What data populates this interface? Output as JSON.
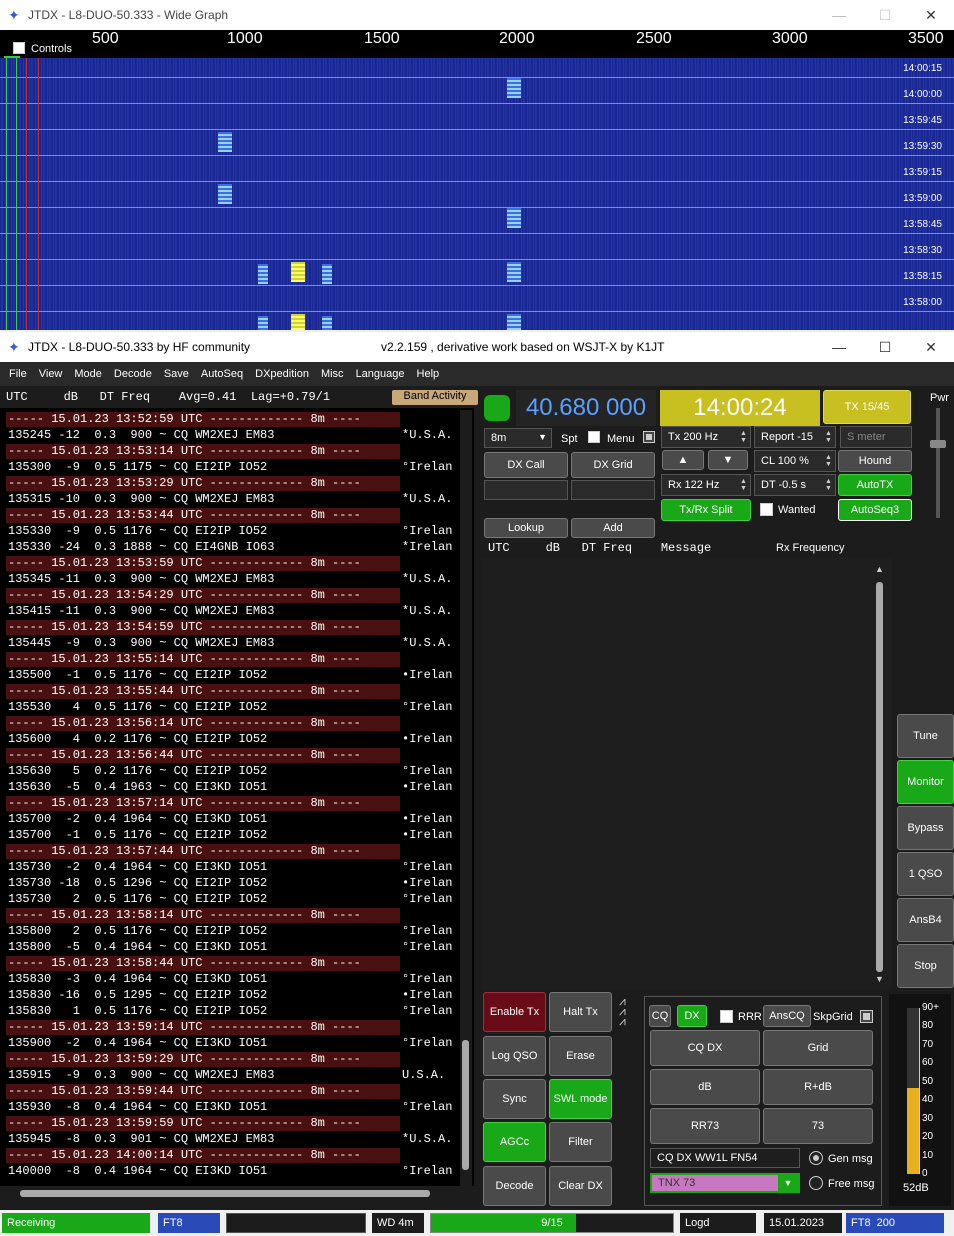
{
  "wide_graph": {
    "title": "JTDX - L8-DUO-50.333 - Wide Graph",
    "controls_label": "Controls",
    "scale_ticks": [
      "500",
      "1000",
      "1500",
      "2000",
      "2500",
      "3000",
      "3500"
    ],
    "times": [
      "14:00:15",
      "14:00:00",
      "13:59:45",
      "13:59:30",
      "13:59:15",
      "13:59:00",
      "13:58:45",
      "13:58:30",
      "13:58:15",
      "13:58:00"
    ]
  },
  "main": {
    "title_left": "JTDX - L8-DUO-50.333  by HF community",
    "title_right": "v2.2.159 , derivative work based on WSJT-X by K1JT",
    "menu": [
      "File",
      "View",
      "Mode",
      "Decode",
      "Save",
      "AutoSeq",
      "DXpedition",
      "Misc",
      "Language",
      "Help"
    ],
    "left_header": "UTC     dB   DT Freq    Avg=0.41  Lag=+0.79/1",
    "band_activity": "Band Activity",
    "lines": [
      {
        "t": "sep",
        "text": "----- 15.01.23 13:52:59 UTC ------------- 8m ----"
      },
      {
        "t": "msg",
        "text": "135245 -12  0.3  900 ~ CQ WM2XEJ EM83",
        "cty": "*U.S.A."
      },
      {
        "t": "sep",
        "text": "----- 15.01.23 13:53:14 UTC ------------- 8m ----"
      },
      {
        "t": "msg",
        "text": "135300  -9  0.5 1175 ~ CQ EI2IP IO52",
        "cty": "°Irelan"
      },
      {
        "t": "sep",
        "text": "----- 15.01.23 13:53:29 UTC ------------- 8m ----"
      },
      {
        "t": "msg",
        "text": "135315 -10  0.3  900 ~ CQ WM2XEJ EM83",
        "cty": "*U.S.A."
      },
      {
        "t": "sep",
        "text": "----- 15.01.23 13:53:44 UTC ------------- 8m ----"
      },
      {
        "t": "msg",
        "text": "135330  -9  0.5 1176 ~ CQ EI2IP IO52",
        "cty": "°Irelan"
      },
      {
        "t": "msg",
        "text": "135330 -24  0.3 1888 ~ CQ EI4GNB IO63",
        "cty": "*Irelan"
      },
      {
        "t": "sep",
        "text": "----- 15.01.23 13:53:59 UTC ------------- 8m ----"
      },
      {
        "t": "msg",
        "text": "135345 -11  0.3  900 ~ CQ WM2XEJ EM83",
        "cty": "*U.S.A."
      },
      {
        "t": "sep",
        "text": "----- 15.01.23 13:54:29 UTC ------------- 8m ----"
      },
      {
        "t": "msg",
        "text": "135415 -11  0.3  900 ~ CQ WM2XEJ EM83",
        "cty": "*U.S.A."
      },
      {
        "t": "sep",
        "text": "----- 15.01.23 13:54:59 UTC ------------- 8m ----"
      },
      {
        "t": "msg",
        "text": "135445  -9  0.3  900 ~ CQ WM2XEJ EM83",
        "cty": "*U.S.A."
      },
      {
        "t": "sep",
        "text": "----- 15.01.23 13:55:14 UTC ------------- 8m ----"
      },
      {
        "t": "msg",
        "text": "135500  -1  0.5 1176 ~ CQ EI2IP IO52",
        "cty": "•Irelan"
      },
      {
        "t": "sep",
        "text": "----- 15.01.23 13:55:44 UTC ------------- 8m ----"
      },
      {
        "t": "msg",
        "text": "135530   4  0.5 1176 ~ CQ EI2IP IO52",
        "cty": "°Irelan"
      },
      {
        "t": "sep",
        "text": "----- 15.01.23 13:56:14 UTC ------------- 8m ----"
      },
      {
        "t": "msg",
        "text": "135600   4  0.2 1176 ~ CQ EI2IP IO52",
        "cty": "•Irelan"
      },
      {
        "t": "sep",
        "text": "----- 15.01.23 13:56:44 UTC ------------- 8m ----"
      },
      {
        "t": "msg",
        "text": "135630   5  0.2 1176 ~ CQ EI2IP IO52",
        "cty": "°Irelan"
      },
      {
        "t": "msg",
        "text": "135630  -5  0.4 1963 ~ CQ EI3KD IO51",
        "cty": "•Irelan"
      },
      {
        "t": "sep",
        "text": "----- 15.01.23 13:57:14 UTC ------------- 8m ----"
      },
      {
        "t": "msg",
        "text": "135700  -2  0.4 1964 ~ CQ EI3KD IO51",
        "cty": "•Irelan"
      },
      {
        "t": "msg",
        "text": "135700  -1  0.5 1176 ~ CQ EI2IP IO52",
        "cty": "•Irelan"
      },
      {
        "t": "sep",
        "text": "----- 15.01.23 13:57:44 UTC ------------- 8m ----"
      },
      {
        "t": "msg",
        "text": "135730  -2  0.4 1964 ~ CQ EI3KD IO51",
        "cty": "°Irelan"
      },
      {
        "t": "msg",
        "text": "135730 -18  0.5 1296 ~ CQ EI2IP IO52",
        "cty": "•Irelan"
      },
      {
        "t": "msg",
        "text": "135730   2  0.5 1176 ~ CQ EI2IP IO52",
        "cty": "°Irelan"
      },
      {
        "t": "sep",
        "text": "----- 15.01.23 13:58:14 UTC ------------- 8m ----"
      },
      {
        "t": "msg",
        "text": "135800   2  0.5 1176 ~ CQ EI2IP IO52",
        "cty": "°Irelan"
      },
      {
        "t": "msg",
        "text": "135800  -5  0.4 1964 ~ CQ EI3KD IO51",
        "cty": "°Irelan"
      },
      {
        "t": "sep",
        "text": "----- 15.01.23 13:58:44 UTC ------------- 8m ----"
      },
      {
        "t": "msg",
        "text": "135830  -3  0.4 1964 ~ CQ EI3KD IO51",
        "cty": "°Irelan"
      },
      {
        "t": "msg",
        "text": "135830 -16  0.5 1295 ~ CQ EI2IP IO52",
        "cty": "•Irelan"
      },
      {
        "t": "msg",
        "text": "135830   1  0.5 1176 ~ CQ EI2IP IO52",
        "cty": "°Irelan"
      },
      {
        "t": "sep",
        "text": "----- 15.01.23 13:59:14 UTC ------------- 8m ----"
      },
      {
        "t": "msg",
        "text": "135900  -2  0.4 1964 ~ CQ EI3KD IO51",
        "cty": "°Irelan"
      },
      {
        "t": "sep",
        "text": "----- 15.01.23 13:59:29 UTC ------------- 8m ----"
      },
      {
        "t": "msg",
        "text": "135915  -9  0.3  900 ~ CQ WM2XEJ EM83",
        "cty": "U.S.A."
      },
      {
        "t": "sep",
        "text": "----- 15.01.23 13:59:44 UTC ------------- 8m ----"
      },
      {
        "t": "msg",
        "text": "135930  -8  0.4 1964 ~ CQ EI3KD IO51",
        "cty": "°Irelan"
      },
      {
        "t": "sep",
        "text": "----- 15.01.23 13:59:59 UTC ------------- 8m ----"
      },
      {
        "t": "msg",
        "text": "135945  -8  0.3  901 ~ CQ WM2XEJ EM83",
        "cty": "*U.S.A."
      },
      {
        "t": "sep",
        "text": "----- 15.01.23 14:00:14 UTC ------------- 8m ----"
      },
      {
        "t": "msg",
        "text": "140000  -8  0.4 1964 ~ CQ EI3KD IO51",
        "cty": "°Irelan"
      }
    ],
    "freq_display": "40.680 000",
    "clock": "14:00:24",
    "tx_period": "TX 15/45",
    "band": "8m",
    "spt": "Spt",
    "menu_chk": "Menu",
    "tx_hz": "Tx  200  Hz",
    "report": "Report -15",
    "smeter": "S meter",
    "dx_call": "DX Call",
    "dx_grid": "DX Grid",
    "cl": "CL  100 %",
    "hound": "Hound",
    "rx_hz": "Rx  122  Hz",
    "dt": "DT -0.5 s",
    "autotx": "AutoTX",
    "txrx_split": "Tx/Rx Split",
    "wanted": "Wanted",
    "autoseq3": "AutoSeq3",
    "lookup": "Lookup",
    "add": "Add",
    "rx_header": "UTC     dB   DT Freq    Message",
    "rx_freq": "Rx Frequency",
    "pwr": "Pwr",
    "side_buttons": [
      "Tune",
      "Monitor",
      "Bypass",
      "1 QSO",
      "AnsB4",
      "Stop"
    ],
    "enable_tx": "Enable Tx",
    "halt_tx": "Halt Tx",
    "log_qso": "Log QSO",
    "erase": "Erase",
    "sync": "Sync",
    "swl_mode": "SWL mode",
    "agcc": "AGCc",
    "filter": "Filter",
    "decode": "Decode",
    "clear_dx": "Clear DX",
    "cq": "CQ",
    "dx": "DX",
    "rrr": "RRR",
    "anscq": "AnsCQ",
    "skpgrid": "SkpGrid",
    "cq_dx": "CQ DX",
    "grid": "Grid",
    "db": "dB",
    "r_db": "R+dB",
    "rr73": "RR73",
    "s73": "73",
    "gen_text": "CQ DX WW1L FN54",
    "gen_msg": "Gen msg",
    "free_text": "TNX 73",
    "free_msg": "Free msg",
    "meter_ticks": [
      "90+",
      "80",
      "70",
      "60",
      "50",
      "40",
      "30",
      "20",
      "10",
      "0"
    ],
    "meter_value": "52dB",
    "meter_level_db": 52
  },
  "status": {
    "receiving": "Receiving",
    "mode": "FT8",
    "wd": "WD 4m",
    "progress": "9/15",
    "progress_fraction": 0.6,
    "logd": "Logd",
    "date": "15.01.2023",
    "ft8_200": "FT8  200"
  },
  "colors": {
    "accent_green": "#18a818",
    "sep_red": "#4a1010",
    "freq_display": "#5aa0ff",
    "clock_bg": "#c8c020"
  }
}
